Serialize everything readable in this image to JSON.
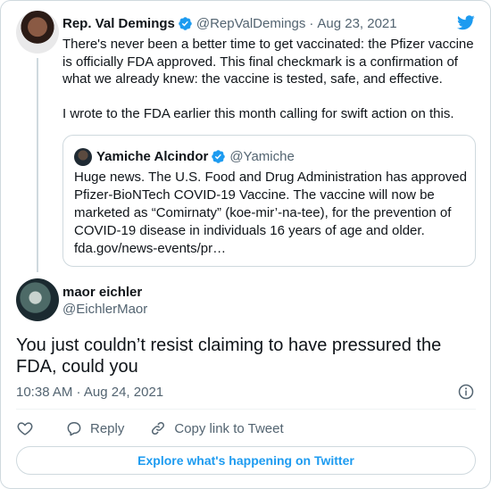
{
  "parent_tweet": {
    "name": "Rep. Val Demings",
    "handle": "@RepValDemings",
    "separator": "·",
    "date": "Aug 23, 2021",
    "text_p1": "There's never been a better time to get vaccinated: the Pfizer vaccine is officially FDA approved. This final checkmark is a confirmation of what we already knew: the vaccine is tested, safe, and effective.",
    "text_p2": "I wrote to the FDA earlier this month calling for swift action on this."
  },
  "quoted_tweet": {
    "name": "Yamiche Alcindor",
    "handle": "@Yamiche",
    "text": "Huge news. The U.S. Food and Drug Administration has approved Pfizer-BioNTech COVID-19 Vaccine. The vaccine will now be marketed as “Comirnaty” (koe-mir’-na-tee), for the prevention of COVID-19 disease in individuals 16 years of age and older. fda.gov/news-events/pr…"
  },
  "reply_tweet": {
    "name": "maor eichler",
    "handle": "@EichlerMaor",
    "text": "You just couldn’t resist claiming to have pressured the FDA, could you",
    "timestamp": "10:38 AM · Aug 24, 2021"
  },
  "actions": {
    "reply_label": "Reply",
    "copy_link_label": "Copy link to Tweet"
  },
  "explore_label": "Explore what's happening on Twitter",
  "icons": {
    "verified": "verified-badge-icon",
    "bird": "twitter-bird-icon",
    "info": "info-icon",
    "heart": "heart-icon",
    "reply": "reply-bubble-icon",
    "link": "link-icon"
  },
  "colors": {
    "accent": "#1d9bf0",
    "text_primary": "#0f1419",
    "text_secondary": "#536471",
    "border": "#cfd9de"
  }
}
